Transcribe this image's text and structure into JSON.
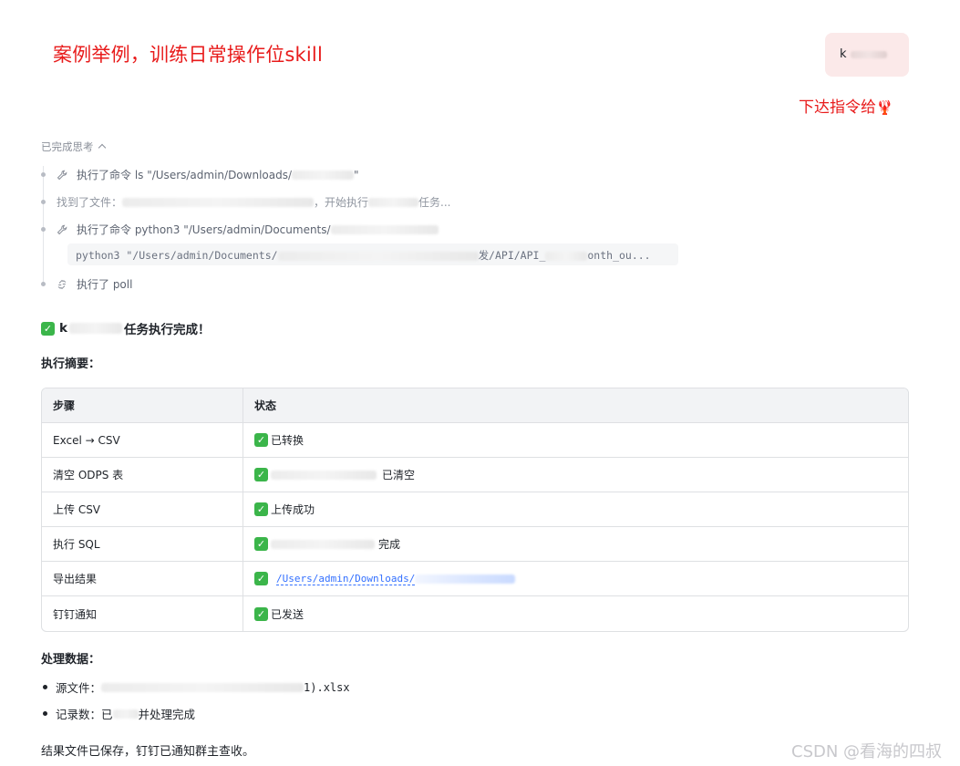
{
  "annotations": {
    "title": "案例举例，训练日常操作位skill",
    "command_hint": "下达指令给",
    "command_emoji": "🦞"
  },
  "user_message": {
    "prefix": "k"
  },
  "thinking": {
    "header": "已完成思考",
    "steps": [
      {
        "icon": "wrench-icon",
        "text": "执行了命令 ls \"/Users/admin/Downloads/",
        "suffix": "\""
      },
      {
        "icon": "none",
        "text": "找到了文件：",
        "middle": "，开始执行",
        "suffix": "任务..."
      },
      {
        "icon": "wrench-icon",
        "text": "执行了命令 python3 \"/Users/admin/Documents/",
        "suffix": ""
      },
      {
        "icon": "poll-icon",
        "text": "执行了 poll"
      }
    ],
    "code": "python3 \"/Users/admin/Documents/",
    "code_tail": "发/API/API_",
    "code_end": "onth_ou..."
  },
  "result": {
    "done_prefix": "k",
    "done_suffix": "任务执行完成！",
    "summary_title": "执行摘要：",
    "table": {
      "headers": [
        "步骤",
        "状态"
      ],
      "rows": [
        {
          "step": "Excel → CSV",
          "status": "已转换"
        },
        {
          "step": "清空 ODPS 表",
          "status": "已清空"
        },
        {
          "step": "上传 CSV",
          "status": "上传成功"
        },
        {
          "step": "执行 SQL",
          "status": "完成"
        },
        {
          "step": "导出结果",
          "status": "/Users/admin/Downloads/"
        },
        {
          "step": "钉钉通知",
          "status": "已发送"
        }
      ]
    },
    "data_title": "处理数据：",
    "source_label": "源文件：",
    "source_tail": "1).xlsx",
    "records_label": "记录数：已",
    "records_suffix": "并处理完成",
    "final_text": "结果文件已保存，钉钉已通知群主查收。"
  },
  "watermark": "CSDN @看海的四叔",
  "colors": {
    "annotation": "#e81b1b",
    "check": "#3bb54a",
    "link": "#3370ff"
  }
}
